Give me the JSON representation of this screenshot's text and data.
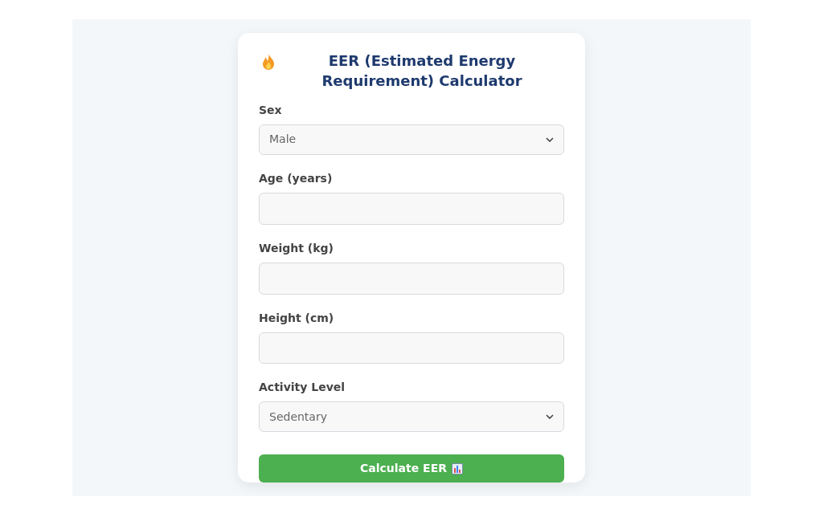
{
  "title": "EER (Estimated Energy Requirement) Calculator",
  "fields": [
    {
      "kind": "select",
      "label": "Sex",
      "value": "Male"
    },
    {
      "kind": "input",
      "label": "Age (years)"
    },
    {
      "kind": "input",
      "label": "Weight (kg)"
    },
    {
      "kind": "input",
      "label": "Height (cm)"
    },
    {
      "kind": "select",
      "label": "Activity Level",
      "value": "Sedentary"
    }
  ],
  "button": {
    "label": "Calculate EER"
  }
}
